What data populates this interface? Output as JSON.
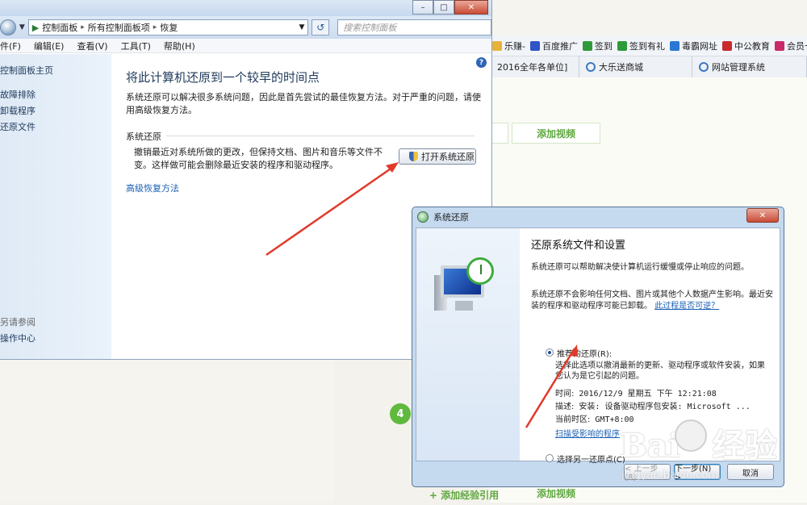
{
  "bookmarks": [
    {
      "label": "乐赚-",
      "color": "#e7b23a"
    },
    {
      "label": "百度推广",
      "color": "#2f55c6"
    },
    {
      "label": "签到",
      "color": "#2f9a3a"
    },
    {
      "label": "签到有礼",
      "color": "#2f9a3a"
    },
    {
      "label": "毒霸网址",
      "color": "#2b77d4"
    },
    {
      "label": "中公教育",
      "color": "#c92a2a"
    },
    {
      "label": "会员卡-",
      "color": "#c92a6a"
    }
  ],
  "browser_tabs": [
    {
      "label": "2016全年各单位]"
    },
    {
      "label": "大乐送商城"
    },
    {
      "label": "网站管理系统"
    }
  ],
  "page_buttons": {
    "top_video": "添加视频",
    "bottom_ref": "+ 添加经验引用",
    "bottom_video": "添加视频",
    "step_number": "4"
  },
  "cp": {
    "breadcrumb": [
      "控制面板",
      "所有控制面板项",
      "恢复"
    ],
    "search_placeholder": "搜索控制面板",
    "menus": [
      "件(F)",
      "编辑(E)",
      "查看(V)",
      "工具(T)",
      "帮助(H)"
    ],
    "side_links": [
      "控制面板主页",
      "故障排除",
      "卸载程序",
      "还原文件"
    ],
    "side_see_also": "另请参阅",
    "side_action_center": "操作中心",
    "title": "将此计算机还原到一个较早的时间点",
    "desc": "系统还原可以解决很多系统问题，因此是首先尝试的最佳恢复方法。对于严重的问题，请使用高级恢复方法。",
    "group_title": "系统还原",
    "group_desc": "撤销最近对系统所做的更改，但保持文档、图片和音乐等文件不变。这样做可能会删除最近安装的程序和驱动程序。",
    "open_button": "打开系统还原",
    "advanced_link": "高级恢复方法"
  },
  "dialog": {
    "title": "系统还原",
    "heading": "还原系统文件和设置",
    "p1": "系统还原可以帮助解决使计算机运行缓慢或停止响应的问题。",
    "p2": "系统还原不会影响任何文档、图片或其他个人数据产生影响。最近安装的程序和驱动程序可能已卸载。",
    "p2_link": "此过程是否可逆？",
    "opt1": "推荐的还原(R):",
    "opt1_desc": "选择此选项以撤消最新的更新、驱动程序或软件安装，如果您认为是它引起的问题。",
    "time_label": "时间:",
    "time_value": "2016/12/9 星期五 下午 12:21:08",
    "desc_label": "描述:",
    "desc_value": "安装: 设备驱动程序包安装: Microsoft ...",
    "tz_label": "当前时区:",
    "tz_value": "GMT+8:00",
    "scan_link": "扫描受影响的程序",
    "opt2": "选择另一还原点(C)",
    "back": "< 上一步(B)",
    "next": "下一步(N) >",
    "cancel": "取消"
  },
  "watermark": {
    "big": "Bai  经验",
    "small": "jingyan.baidu.com"
  },
  "colors": {
    "accent_link": "#1a5fb4",
    "green": "#5fa83f",
    "arrow": "#e03a2a"
  }
}
